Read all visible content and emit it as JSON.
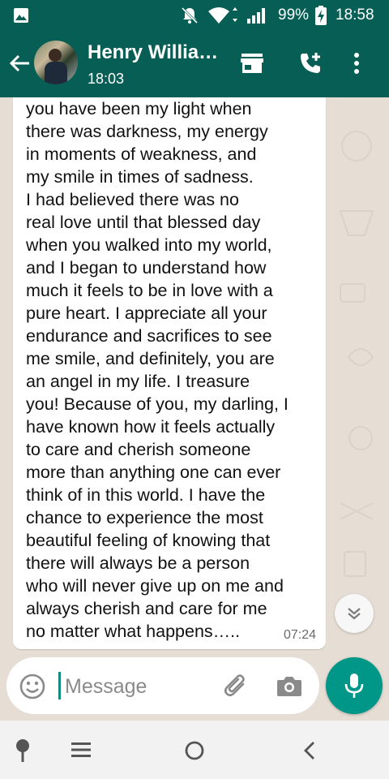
{
  "status_bar": {
    "battery_percent": "99%",
    "time": "18:58",
    "icons": [
      "gallery-icon",
      "mute-icon",
      "wifi-icon",
      "signal-icon",
      "battery-charging-icon"
    ]
  },
  "header": {
    "contact_name": "Henry Willia…",
    "last_seen": "18:03",
    "icons": [
      "back-arrow-icon",
      "avatar",
      "shop-icon",
      "add-call-icon",
      "more-vert-icon"
    ]
  },
  "message": {
    "lines": [
      "you have been my light when",
      "there was darkness, my energy",
      "in moments of weakness, and",
      "my smile in times of sadness.",
      "I had believed there was no",
      "real love until that blessed day",
      "when you walked into my world,",
      "and I began to understand how",
      "much it feels to be in love with a",
      "pure heart. I appreciate all your",
      "endurance and sacrifices to see",
      "me smile, and definitely, you are",
      "an angel in my life. I treasure",
      "you! Because of you, my darling, I",
      "have known how it feels actually",
      "to care and cherish someone",
      "more than anything one can ever",
      "think of in this world. I have the",
      "chance to experience the most",
      "beautiful feeling of knowing that",
      "there will always be a person",
      "who will never give up on me and",
      "always cherish and care for me",
      "no matter what happens….."
    ],
    "time": "07:24"
  },
  "composer": {
    "placeholder": "Message",
    "value": "",
    "icons": [
      "emoji-icon",
      "attach-icon",
      "camera-icon",
      "mic-icon"
    ]
  },
  "nav_bar": {
    "icons": [
      "pin-icon",
      "menu-icon",
      "home-icon",
      "back-icon"
    ]
  },
  "colors": {
    "header_bg": "#075e54",
    "accent": "#009688",
    "chat_bg": "#e6ddd4",
    "bubble_bg": "#ffffff"
  }
}
